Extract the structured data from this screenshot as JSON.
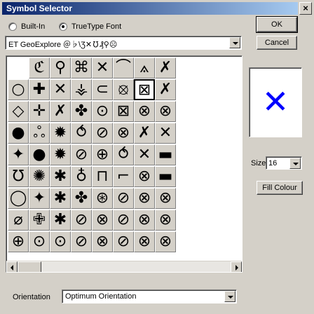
{
  "window": {
    "title": "Symbol Selector",
    "close_glyph": "×"
  },
  "font_type": {
    "options": [
      {
        "label": "Built-In",
        "checked": false
      },
      {
        "label": "TrueType Font",
        "checked": true
      }
    ]
  },
  "font_select": {
    "value": "ET GeoExplore ＠♭\\Ʒ✕℧₰⚲☹ "
  },
  "buttons": {
    "ok": "OK",
    "cancel": "Cancel",
    "fill_colour": "Fill Colour"
  },
  "symbols": [
    "ℭ",
    "⚲",
    "⌘",
    "✕",
    "⌒",
    "⟑",
    "✗",
    "○",
    "✚",
    "✕",
    "⚶",
    "⊂",
    "⦻",
    "⊠",
    "✗",
    "◇",
    "✛",
    "✗",
    "✤",
    "⊙",
    "⊠",
    "⊗",
    "⊗",
    "●",
    "ஃ",
    "✹",
    "⥀",
    "⊘",
    "⊗",
    "✗",
    "✕",
    "✦",
    "●",
    "✹",
    "⊘",
    "⊕",
    "⥀",
    "✕",
    "▬",
    "℧",
    "✺",
    "✱",
    "♁",
    "⊓",
    "⌐",
    "⊗",
    "▬",
    "◯",
    "✦",
    "✱",
    "✤",
    "⊛",
    "⊘",
    "⊗",
    "⊗",
    "⌀",
    "✙",
    "✱",
    "⊘",
    "⊗",
    "⊘",
    "⊗",
    "⊗",
    "⊕",
    "⊙",
    "⊙",
    "⊘",
    "⊗",
    "⊘",
    "⊗",
    "⊗",
    "⊕",
    "⊕",
    "⊕",
    "⊘",
    "⊗",
    "⊘",
    "⊗",
    "⊗"
  ],
  "selected_symbol": "✕",
  "preview": {
    "symbol": "✕",
    "color": "#0000ff"
  },
  "size": {
    "label": "Size",
    "value": "16"
  },
  "orientation": {
    "label": "Orientation",
    "value": "Optimum Orientation"
  },
  "colors": {
    "title_start": "#0a246a",
    "title_end": "#a6caf0",
    "face": "#d4d0c8"
  }
}
